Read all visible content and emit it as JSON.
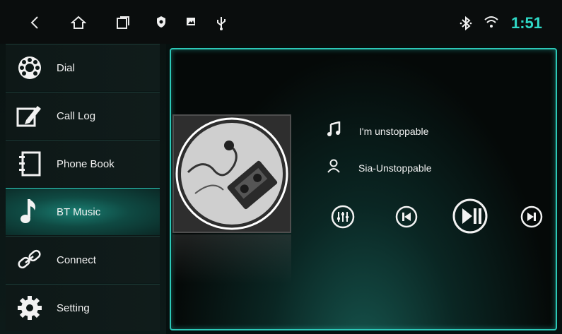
{
  "statusbar": {
    "time": "1:51",
    "icons": [
      "back-icon",
      "home-icon",
      "recent-apps-icon",
      "shield-icon",
      "image-icon",
      "usb-icon",
      "bluetooth-icon",
      "wifi-icon"
    ],
    "accent": "#2fd9c7"
  },
  "sidebar": {
    "items": [
      {
        "label": "Dial",
        "icon": "dial-icon",
        "active": false
      },
      {
        "label": "Call Log",
        "icon": "call-log-icon",
        "active": false
      },
      {
        "label": "Phone Book",
        "icon": "phone-book-icon",
        "active": false
      },
      {
        "label": "BT Music",
        "icon": "music-note-icon",
        "active": true
      },
      {
        "label": "Connect",
        "icon": "link-icon",
        "active": false
      },
      {
        "label": "Setting",
        "icon": "gear-icon",
        "active": false
      }
    ]
  },
  "player": {
    "track": "I'm unstoppable",
    "artist": "Sia-Unstoppable",
    "controls": [
      "equalizer-icon",
      "previous-icon",
      "play-pause-icon",
      "next-icon"
    ]
  }
}
